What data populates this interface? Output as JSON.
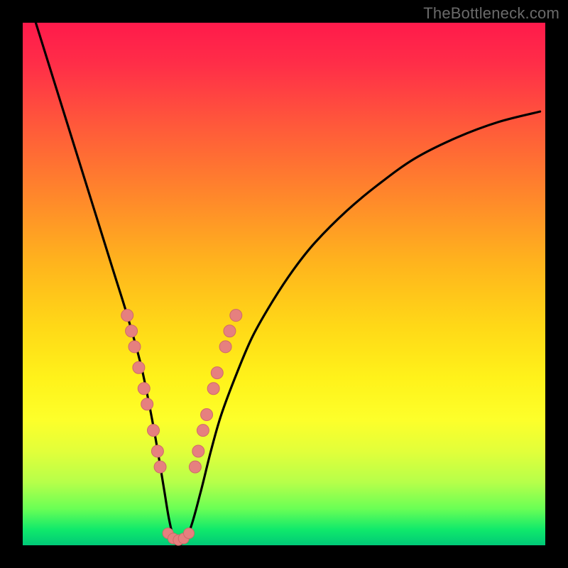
{
  "watermark": "TheBottleneck.com",
  "colors": {
    "frame": "#000000",
    "curve": "#000000",
    "dot_fill": "#e6807f",
    "dot_stroke": "#cf6a69",
    "gradient_top": "#ff1a4b",
    "gradient_bottom": "#00c977"
  },
  "chart_data": {
    "type": "line",
    "title": "",
    "xlabel": "",
    "ylabel": "",
    "xlim": [
      0,
      100
    ],
    "ylim": [
      0,
      100
    ],
    "series": [
      {
        "name": "bottleneck-curve",
        "x": [
          2.5,
          5,
          7.5,
          10,
          12.5,
          15,
          17.5,
          20,
          22.5,
          24,
          25.5,
          27,
          28,
          29,
          30,
          32,
          34,
          36,
          38,
          41,
          44,
          48,
          52,
          56,
          62,
          68,
          75,
          83,
          91,
          99
        ],
        "values": [
          100,
          92,
          84,
          76,
          68,
          60,
          52,
          44,
          35,
          28,
          20,
          11,
          5,
          1,
          0,
          3,
          10,
          18,
          25,
          33,
          40,
          47,
          53,
          58,
          64,
          69,
          74,
          78,
          81,
          83
        ]
      }
    ],
    "annotations": {
      "dots_left": [
        {
          "x": 20.0,
          "y": 44
        },
        {
          "x": 20.8,
          "y": 41
        },
        {
          "x": 21.4,
          "y": 38
        },
        {
          "x": 22.2,
          "y": 34
        },
        {
          "x": 23.2,
          "y": 30
        },
        {
          "x": 23.8,
          "y": 27
        },
        {
          "x": 25.0,
          "y": 22
        },
        {
          "x": 25.8,
          "y": 18
        },
        {
          "x": 26.3,
          "y": 15
        }
      ],
      "dots_bottom": [
        {
          "x": 27.8,
          "y": 2.3
        },
        {
          "x": 28.8,
          "y": 1.3
        },
        {
          "x": 29.8,
          "y": 1.0
        },
        {
          "x": 30.8,
          "y": 1.3
        },
        {
          "x": 31.8,
          "y": 2.3
        }
      ],
      "dots_right": [
        {
          "x": 33.0,
          "y": 15
        },
        {
          "x": 33.6,
          "y": 18
        },
        {
          "x": 34.5,
          "y": 22
        },
        {
          "x": 35.2,
          "y": 25
        },
        {
          "x": 36.5,
          "y": 30
        },
        {
          "x": 37.2,
          "y": 33
        },
        {
          "x": 38.8,
          "y": 38
        },
        {
          "x": 39.6,
          "y": 41
        },
        {
          "x": 40.8,
          "y": 44
        }
      ]
    }
  }
}
